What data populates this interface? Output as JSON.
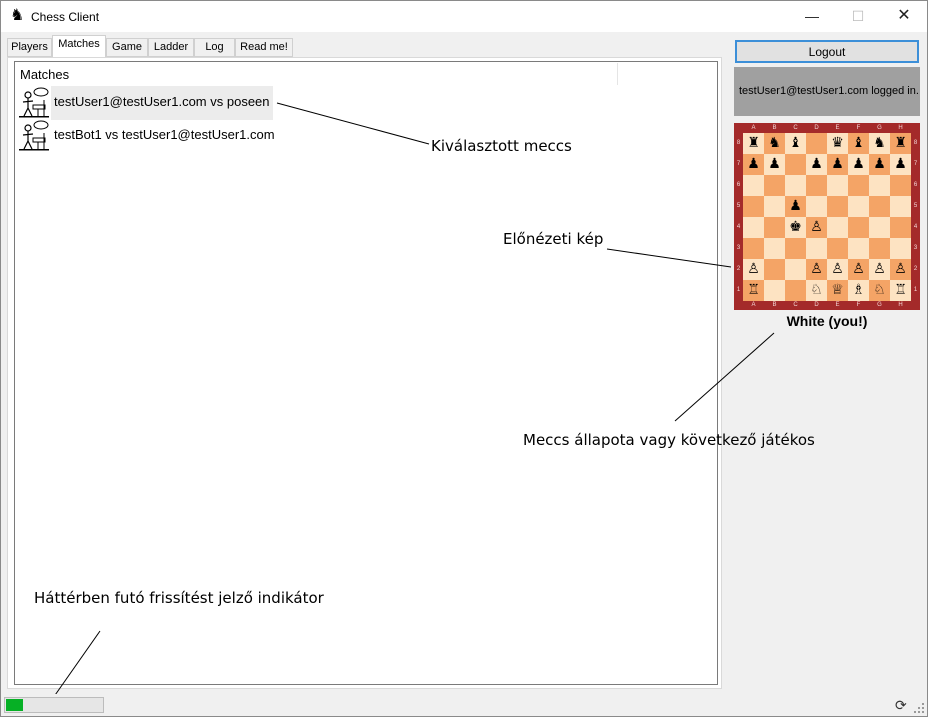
{
  "window": {
    "title": "Chess Client",
    "minimize_label": "—",
    "maximize_label": "☐",
    "close_label": "✕"
  },
  "tabs": [
    {
      "label": "Players"
    },
    {
      "label": "Matches",
      "active": true
    },
    {
      "label": "Game"
    },
    {
      "label": "Ladder"
    },
    {
      "label": "Log"
    },
    {
      "label": "Read me!"
    }
  ],
  "matches": {
    "header": "Matches",
    "items": [
      {
        "label": "testUser1@testUser1.com vs poseen",
        "icon": "chess-players-icon",
        "selected": true
      },
      {
        "label": "testBot1 vs testUser1@testUser1.com",
        "icon": "chess-players-icon",
        "selected": false
      }
    ]
  },
  "sidebar": {
    "logout_label": "Logout",
    "login_status": "testUser1@testUser1.com logged in.",
    "match_status": "White (you!)"
  },
  "board": {
    "files": [
      "A",
      "B",
      "C",
      "D",
      "E",
      "F",
      "G",
      "H"
    ],
    "ranks": [
      "8",
      "7",
      "6",
      "5",
      "4",
      "3",
      "2",
      "1"
    ],
    "rows": [
      [
        "♜",
        "♞",
        "♝",
        "",
        "♛",
        "♝",
        "♞",
        "♜"
      ],
      [
        "♟",
        "♟",
        "",
        "♟",
        "♟",
        "♟",
        "♟",
        "♟"
      ],
      [
        "",
        "",
        "",
        "",
        "",
        "",
        "",
        ""
      ],
      [
        "",
        "",
        "♟",
        "",
        "",
        "",
        "",
        ""
      ],
      [
        "",
        "",
        "♚",
        "♙",
        "",
        "",
        "",
        ""
      ],
      [
        "",
        "",
        "",
        "",
        "",
        "",
        "",
        ""
      ],
      [
        "♙",
        "",
        "",
        "♙",
        "♙",
        "♙",
        "♙",
        "♙"
      ],
      [
        "♖",
        "",
        "",
        "♘",
        "♕",
        "♗",
        "♘",
        "♖"
      ]
    ],
    "light_color": "#fde3c2",
    "dark_color": "#f4a466",
    "frame_color": "#a42a2a"
  },
  "annotations": {
    "selected_match": "Kiválasztott meccs",
    "preview_image": "Előnézeti kép",
    "match_status": "Meccs állapota vagy következő játékos",
    "refresh_indicator": "Háttérben futó frissítést jelző indikátor"
  },
  "statusbar": {
    "progress": 0.18,
    "progress_color": "#06b025"
  }
}
